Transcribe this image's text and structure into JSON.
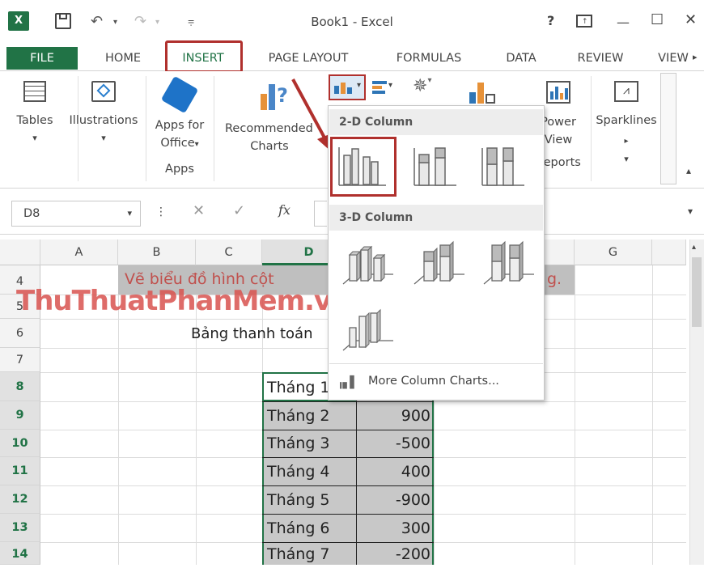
{
  "window": {
    "title": "Book1 - Excel",
    "help": "?",
    "min": "—",
    "max": "☐",
    "close": "✕"
  },
  "tabs": [
    "FILE",
    "HOME",
    "INSERT",
    "PAGE LAYOUT",
    "FORMULAS",
    "DATA",
    "REVIEW",
    "VIEW"
  ],
  "ribbon": {
    "tables": "Tables",
    "illustrations": "Illustrations",
    "apps_line1": "Apps for",
    "apps_line2": "Office",
    "apps_group": "Apps",
    "recommended_line1": "Recommended",
    "recommended_line2": "Charts",
    "power_line1": "Power",
    "power_line2": "View",
    "reports_group": "Reports",
    "sparklines": "Sparklines",
    "arrow": "▾"
  },
  "formula_bar": {
    "name_box": "D8",
    "cancel": "✕",
    "enter": "✓",
    "fx": "fx"
  },
  "columns": [
    "A",
    "B",
    "C",
    "D",
    "G"
  ],
  "rows": [
    "4",
    "5",
    "6",
    "7",
    "8",
    "9",
    "10",
    "11",
    "12",
    "13",
    "14"
  ],
  "sheet": {
    "row4_title": "Vẽ biểu đồ hình cột",
    "row4_right": "g.",
    "row6_text": "Bảng thanh toán",
    "months": [
      "Tháng 1",
      "Tháng 2",
      "Tháng 3",
      "Tháng 4",
      "Tháng 5",
      "Tháng 6",
      "Tháng 7"
    ],
    "values": [
      "",
      "900",
      "-500",
      "400",
      "-900",
      "300",
      "-200"
    ]
  },
  "watermark": "ThuThuatPhanMem.vn",
  "dropdown": {
    "section_2d": "2-D Column",
    "section_3d": "3-D Column",
    "more": "More Column Charts..."
  },
  "colors": {
    "accent": "#217346",
    "highlight": "#b0302d",
    "watermark": "#d9534f"
  }
}
